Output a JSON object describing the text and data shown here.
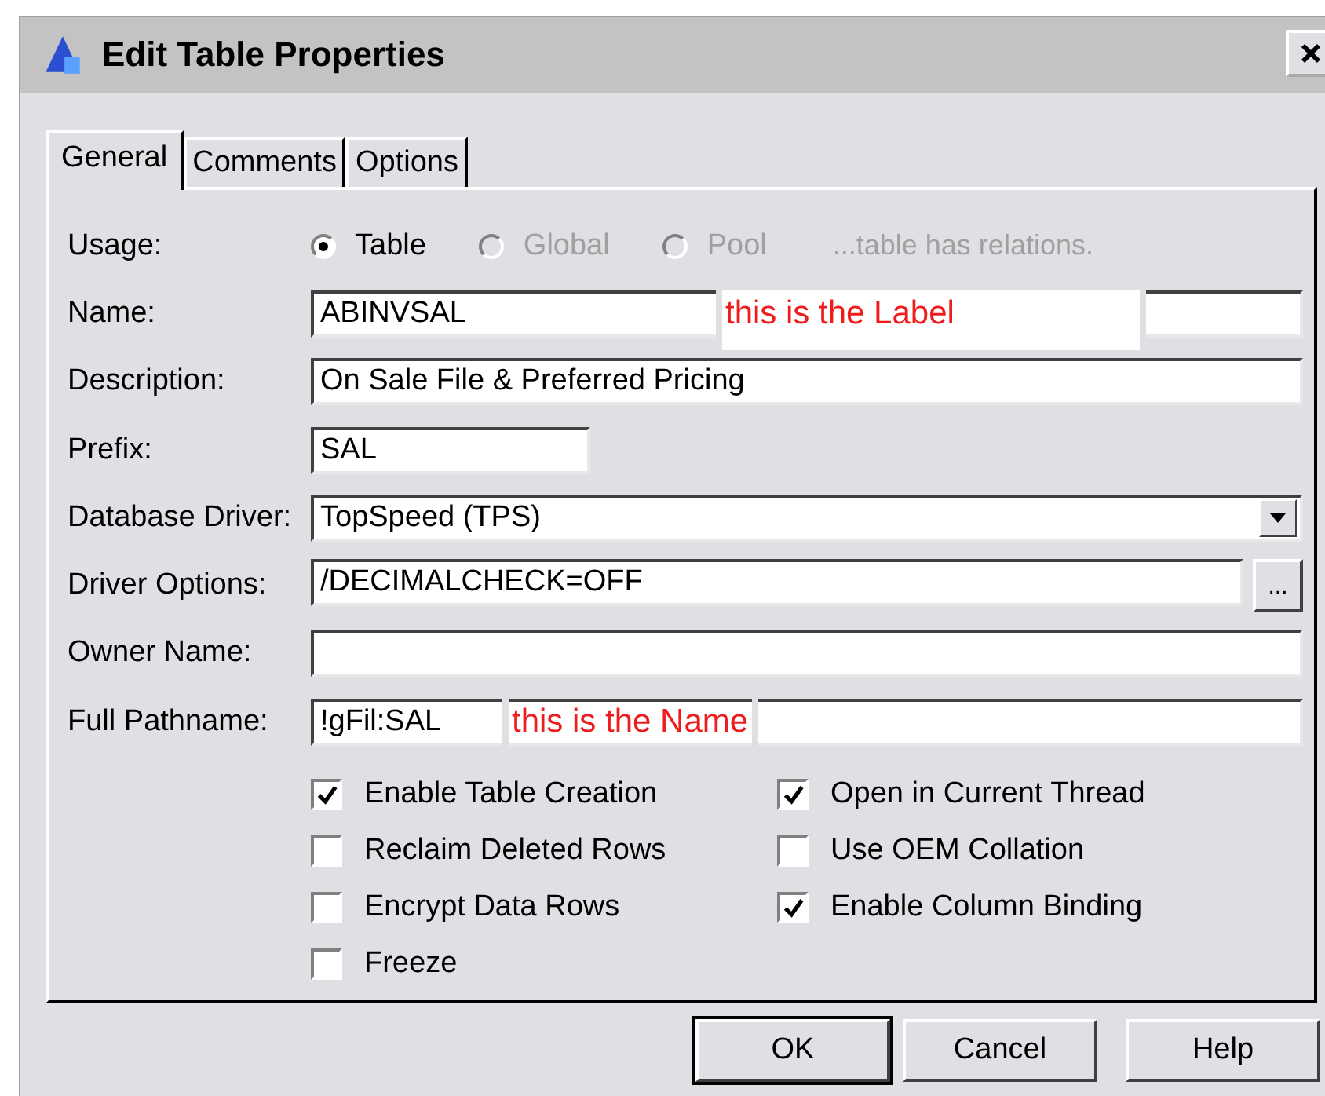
{
  "window": {
    "title": "Edit Table Properties"
  },
  "tabs": [
    {
      "label": "General",
      "selected": true
    },
    {
      "label": "Comments",
      "selected": false
    },
    {
      "label": "Options",
      "selected": false
    }
  ],
  "usage": {
    "label": "Usage:",
    "options": [
      {
        "label": "Table",
        "selected": true,
        "disabled": false
      },
      {
        "label": "Global",
        "selected": false,
        "disabled": true
      },
      {
        "label": "Pool",
        "selected": false,
        "disabled": true
      }
    ],
    "note": "...table has relations."
  },
  "fields": [
    {
      "kind": "text",
      "label": "Name:",
      "value": "ABINVSAL",
      "annotation": "this is the Label"
    },
    {
      "kind": "text",
      "label": "Description:",
      "value": "On Sale File & Preferred Pricing"
    },
    {
      "kind": "short",
      "label": "Prefix:",
      "value": "SAL"
    },
    {
      "kind": "dropdown",
      "label": "Database Driver:",
      "value": "TopSpeed (TPS)"
    },
    {
      "kind": "browse",
      "label": "Driver Options:",
      "value": "/DECIMALCHECK=OFF",
      "button": "..."
    },
    {
      "kind": "text",
      "label": "Owner Name:"
    },
    {
      "kind": "text",
      "label": "Full Pathname:",
      "value": "!gFil:SAL",
      "annotation": "this is the Name"
    }
  ],
  "checkboxes": [
    {
      "label": "Enable Table Creation",
      "checked": true
    },
    {
      "label": "Open in Current Thread",
      "checked": true
    },
    {
      "label": "Reclaim Deleted Rows",
      "checked": false
    },
    {
      "label": "Use OEM Collation",
      "checked": false
    },
    {
      "label": "Encrypt Data Rows",
      "checked": false
    },
    {
      "label": "Enable Column Binding",
      "checked": true
    },
    {
      "label": "Freeze",
      "checked": false
    }
  ],
  "buttons": [
    {
      "label": "OK",
      "default": true
    },
    {
      "label": "Cancel",
      "default": false
    },
    {
      "label": "Help",
      "default": false
    }
  ]
}
